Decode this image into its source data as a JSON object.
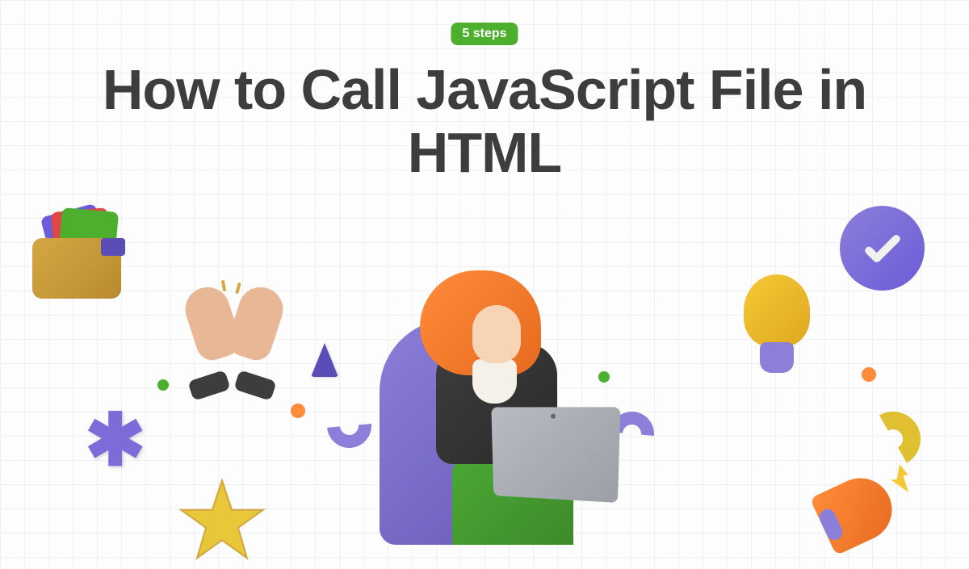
{
  "badge": {
    "label": "5 steps"
  },
  "title": "How to Call JavaScript File in HTML",
  "colors": {
    "badge_bg": "#4CAF2E",
    "title_text": "#3d3d3d",
    "accent_purple": "#8b7fd9",
    "accent_yellow": "#f5c835",
    "accent_orange": "#ff8c3a",
    "accent_green": "#4CAF2E"
  },
  "decorative_icons": [
    "wallet-with-cards",
    "clapping-hands",
    "lightbulb",
    "checkmark-badge",
    "asterisk",
    "star",
    "megaphone",
    "cone",
    "squiggle",
    "dots"
  ]
}
